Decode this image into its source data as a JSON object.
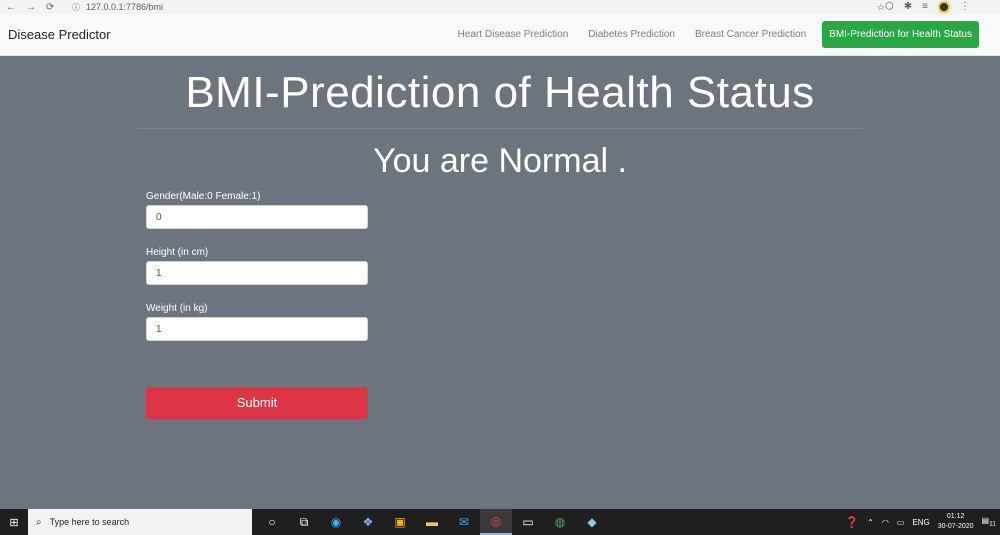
{
  "browser": {
    "url": "127.0.0.1:7786/bmi"
  },
  "navbar": {
    "brand": "Disease Predictor",
    "links": [
      {
        "label": "Heart Disease Prediction"
      },
      {
        "label": "Diabetes Prediction"
      },
      {
        "label": "Breast Cancer Prediction"
      },
      {
        "label": "BMI-Prediction for Health Status",
        "active": true
      }
    ],
    "active_color": "#28a745"
  },
  "main": {
    "title": "BMI-Prediction of Health Status",
    "result": "You are Normal .",
    "background": "#6c757d",
    "fields": [
      {
        "label": "Gender(Male:0 Female:1)",
        "value": "0"
      },
      {
        "label": "Height (in cm)",
        "value": "1"
      },
      {
        "label": "Weight (in kg)",
        "value": "1"
      }
    ],
    "submit_label": "Submit",
    "submit_color": "#dc3545"
  },
  "taskbar": {
    "search_placeholder": "Type here to search",
    "language": "ENG",
    "time": "01:12",
    "date": "30-07-2020",
    "notification_count": "11"
  }
}
